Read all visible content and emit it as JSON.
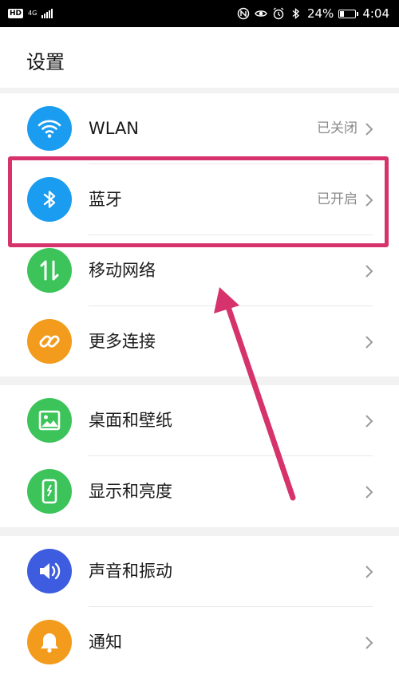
{
  "status_bar": {
    "hd": "HD",
    "network": "4G",
    "battery_percent": "24%",
    "time": "4:04",
    "icons": [
      "nfc-icon",
      "eye-icon",
      "alarm-icon",
      "bluetooth-icon",
      "battery-icon"
    ]
  },
  "header": {
    "title": "设置"
  },
  "sections": [
    {
      "items": [
        {
          "id": "wlan",
          "label": "WLAN",
          "value": "已关闭",
          "icon": "wifi-icon",
          "color": "#1a9cf0"
        },
        {
          "id": "bluetooth",
          "label": "蓝牙",
          "value": "已开启",
          "icon": "bluetooth-icon",
          "color": "#1a9cf0"
        },
        {
          "id": "mobile-network",
          "label": "移动网络",
          "value": "",
          "icon": "mobile-data-icon",
          "color": "#3cc45a"
        },
        {
          "id": "more-connections",
          "label": "更多连接",
          "value": "",
          "icon": "link-icon",
          "color": "#f39b1c"
        }
      ]
    },
    {
      "items": [
        {
          "id": "wallpaper",
          "label": "桌面和壁纸",
          "value": "",
          "icon": "image-icon",
          "color": "#3cc45a"
        },
        {
          "id": "display",
          "label": "显示和亮度",
          "value": "",
          "icon": "phone-brightness-icon",
          "color": "#3cc45a"
        }
      ]
    },
    {
      "items": [
        {
          "id": "sound",
          "label": "声音和振动",
          "value": "",
          "icon": "speaker-icon",
          "color": "#3e5ce0"
        },
        {
          "id": "notifications",
          "label": "通知",
          "value": "",
          "icon": "bell-icon",
          "color": "#f39b1c"
        }
      ]
    }
  ],
  "annotation": {
    "highlight_color": "#d6336c"
  }
}
